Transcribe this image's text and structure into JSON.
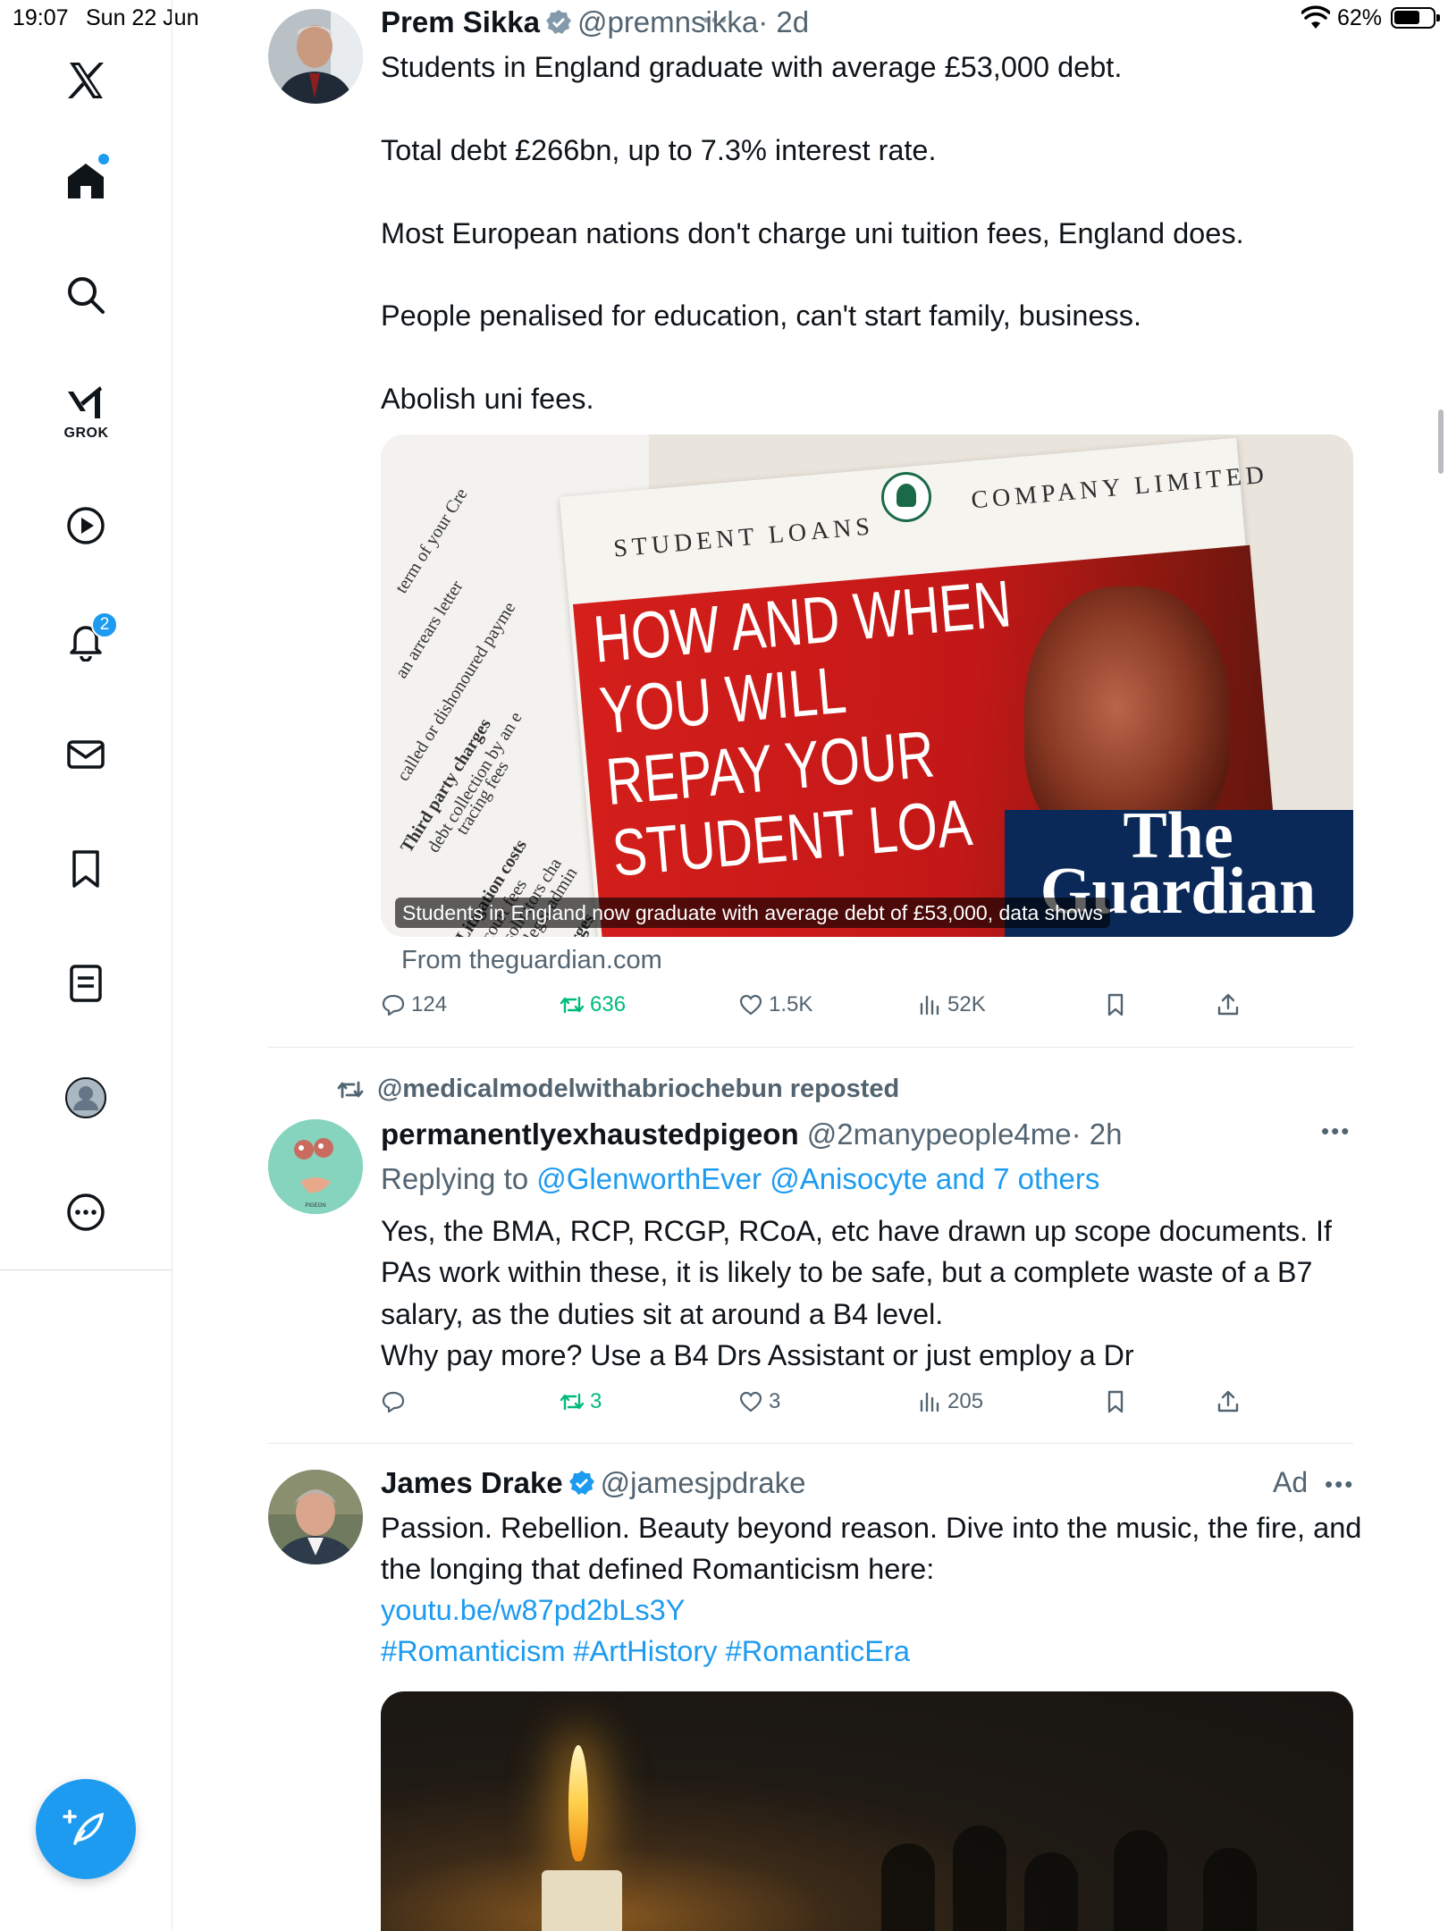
{
  "status_bar": {
    "time": "19:07",
    "date": "Sun 22 Jun",
    "battery": "62%"
  },
  "sidebar": {
    "grok_label": "GROK",
    "notifications_count": "2",
    "items": [
      "x-logo",
      "home",
      "search",
      "grok",
      "videos",
      "notifications",
      "messages",
      "bookmarks",
      "lists",
      "profile",
      "more"
    ]
  },
  "tweets": [
    {
      "name": "Prem Sikka",
      "handle": "@premnsikka",
      "time": "· 2d",
      "text": "Students in England graduate with average £53,000 debt.\n\nTotal debt £266bn, up to 7.3% interest rate.\n\nMost European nations don't charge uni tuition fees, England does.\n\nPeople penalised for education, can't start family, business.\n\nAbolish uni fees.",
      "card": {
        "caption": "Students in England now graduate with average debt of £53,000, data shows",
        "source": "From theguardian.com",
        "image_text": {
          "student_loans": "STUDENT LOANS",
          "company_limited": "COMPANY LIMITED",
          "headline": "HOW AND WHEN\nYOU WILL\nREPAY YOUR\nSTUDENT LOA",
          "brand": "The\nGuardian",
          "paper_lines": [
            "term of your Cre",
            "an arrears letter",
            "called or dishonoured payme",
            "Third party charges",
            "debt collection by an e",
            "tracing fees",
            "Litigation costs",
            "court fees",
            "solicitors cha",
            "legal admin",
            "The charges"
          ]
        }
      },
      "stats": {
        "replies": "124",
        "reposts": "636",
        "likes": "1.5K",
        "views": "52K"
      }
    },
    {
      "repost_by": "@medicalmodelwithabriochebun reposted",
      "name": "permanentlyexhaustedpigeon",
      "handle": "@2manypeople4me",
      "time": "· 2h",
      "replying_prefix": "Replying to ",
      "replying_to": "@GlenworthEver @Anisocyte and 7 others",
      "text": "Yes, the BMA, RCP, RCGP, RCoA, etc have drawn up scope documents. If PAs work within these, it is likely to be safe, but a complete waste of a B7 salary, as the duties sit at around a B4 level.\nWhy pay more? Use a B4 Drs Assistant or just employ a Dr",
      "stats": {
        "replies": "",
        "reposts": "3",
        "likes": "3",
        "views": "205"
      }
    },
    {
      "name": "James Drake",
      "handle": "@jamesjpdrake",
      "ad_label": "Ad",
      "text": "Passion. Rebellion. Beauty beyond reason. Dive into the music, the fire, and the longing that defined Romanticism here:",
      "link": "youtu.be/w87pd2bLs3Y",
      "hashtags": "#Romanticism #ArtHistory #RomanticEra"
    }
  ],
  "colors": {
    "accent": "#1d9bf0",
    "repost": "#00ba7c",
    "muted": "#536471",
    "guardian_navy": "#0b2958",
    "loan_red": "#d51f1b"
  }
}
